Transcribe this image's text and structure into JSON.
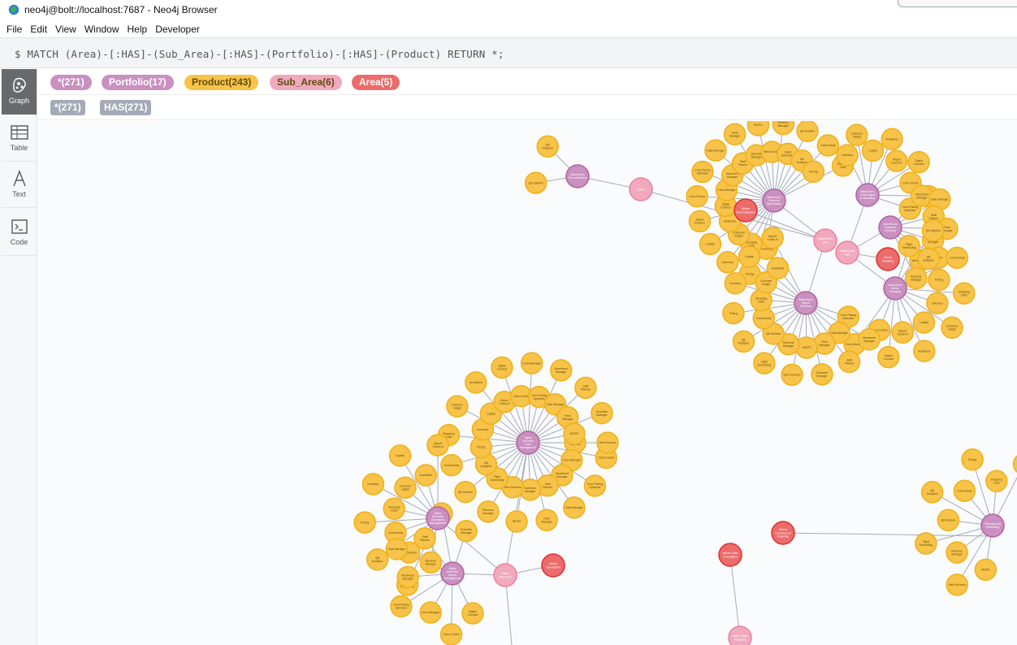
{
  "window": {
    "title": "neo4j@bolt://localhost:7687 - Neo4j Browser"
  },
  "menu": [
    "File",
    "Edit",
    "View",
    "Window",
    "Help",
    "Developer"
  ],
  "editor": {
    "query": "$ MATCH (Area)-[:HAS]-(Sub_Area)-[:HAS]-(Portfolio)-[:HAS]-(Product) RETURN *;"
  },
  "sidebar": [
    {
      "label": "Graph",
      "icon": "graph-icon",
      "active": true
    },
    {
      "label": "Table",
      "icon": "table-icon",
      "active": false
    },
    {
      "label": "Text",
      "icon": "text-icon",
      "active": false
    },
    {
      "label": "Code",
      "icon": "code-icon",
      "active": false
    }
  ],
  "node_labels": [
    {
      "label": "*(271)",
      "color": "#c990c0",
      "text": "#ffffff"
    },
    {
      "label": "Portfolio(17)",
      "color": "#c990c0",
      "text": "#ffffff"
    },
    {
      "label": "Product(243)",
      "color": "#f7c349",
      "text": "#604a0e"
    },
    {
      "label": "Sub_Area(6)",
      "color": "#f1a9be",
      "text": "#604a0e"
    },
    {
      "label": "Area(5)",
      "color": "#ec6b6b",
      "text": "#ffffff"
    }
  ],
  "rel_types": [
    {
      "label": "*(271)"
    },
    {
      "label": "HAS(271)"
    }
  ],
  "colors": {
    "product": "#f7c349",
    "product_stroke": "#f0b017",
    "portfolio": "#c990c0",
    "portfolio_stroke": "#b261a5",
    "sub_area": "#f1a9be",
    "sub_area_stroke": "#eb7f9f",
    "area": "#ec6b6b",
    "area_stroke": "#e02e2e",
    "edge": "#a5abb6"
  },
  "graph": {
    "areas": [
      {
        "text": "Airline Personalization"
      },
      {
        "text": "Airline Retailing"
      },
      {
        "text": "Airline Operations"
      },
      {
        "text": "Airline Commercial Planning"
      },
      {
        "text": "Airline Data & Analytics"
      }
    ],
    "sub_areas": [
      {
        "text": "Sabre"
      },
      {
        "text": "SabreSonic CSS"
      },
      {
        "text": "SabreSonic CSS"
      },
      {
        "text": "Sabre AirCentre"
      },
      {
        "text": "Sabre Data Analytics"
      }
    ],
    "portfolios": [
      {
        "text": "SabreSonic Personalization"
      },
      {
        "text": "SabreSonic Revenue Optimization"
      },
      {
        "text": "SabreSonic Travel Agent & Marketing"
      },
      {
        "text": "SabreSonic Customer Centricity"
      },
      {
        "text": "SabreSonic Airline Shopping"
      },
      {
        "text": "SabreSonic Airport Solutions"
      },
      {
        "text": "Sabre AirCentre Crew Management"
      },
      {
        "text": "Sabre AirCentre Operations Management"
      },
      {
        "text": "Sabre AirCentre Airport Management"
      },
      {
        "text": "Planning and Scheduling"
      }
    ],
    "product_labels": [
      "Qik Solution",
      "Qik Analytics",
      "Connectivity",
      "Pricing",
      "Shopping Carts",
      "Inventory",
      "Customer Insight",
      "Loyalty",
      "Ancillaries",
      "Airport Check-in",
      "Digital Connect",
      "Crew Control",
      "Crew Manager",
      "Crew Pairing Optimizer",
      "Movement Manager",
      "Gate Manager",
      "Staff Planner",
      "Fleet Manager",
      "Schedule Manager",
      "iROPS",
      "Web Services",
      "Revenue Manager",
      "Flight Scheduling"
    ]
  }
}
